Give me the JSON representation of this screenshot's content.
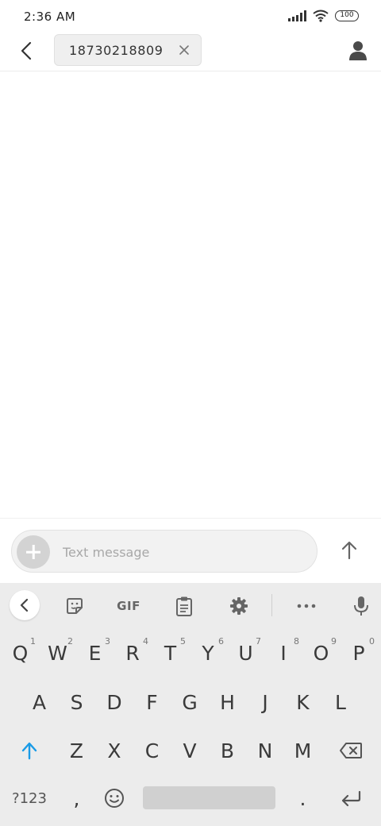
{
  "status_bar": {
    "time": "2:36 AM",
    "battery": "100",
    "icons": [
      "signal-icon",
      "wifi-icon",
      "battery-icon"
    ]
  },
  "header": {
    "recipient": "18730218809",
    "icons": [
      "back-icon",
      "close-icon",
      "contact-icon"
    ]
  },
  "compose": {
    "placeholder": "Text message",
    "value": "",
    "icons": [
      "add-attachment-icon",
      "send-arrow-icon"
    ]
  },
  "keyboard": {
    "toolbar": {
      "gif_label": "GIF",
      "icons": [
        "collapse-chevron-icon",
        "sticker-icon",
        "clipboard-icon",
        "settings-gear-icon",
        "more-dots-icon",
        "microphone-icon"
      ]
    },
    "row1": [
      {
        "label": "Q",
        "hint": "1"
      },
      {
        "label": "W",
        "hint": "2"
      },
      {
        "label": "E",
        "hint": "3"
      },
      {
        "label": "R",
        "hint": "4"
      },
      {
        "label": "T",
        "hint": "5"
      },
      {
        "label": "Y",
        "hint": "6"
      },
      {
        "label": "U",
        "hint": "7"
      },
      {
        "label": "I",
        "hint": "8"
      },
      {
        "label": "O",
        "hint": "9"
      },
      {
        "label": "P",
        "hint": "0"
      }
    ],
    "row2": [
      "A",
      "S",
      "D",
      "F",
      "G",
      "H",
      "J",
      "K",
      "L"
    ],
    "row3": [
      "Z",
      "X",
      "C",
      "V",
      "B",
      "N",
      "M"
    ],
    "bottom": {
      "symbols_label": "?123",
      "comma": ",",
      "period": "."
    },
    "accent_color": "#1a9be6"
  }
}
